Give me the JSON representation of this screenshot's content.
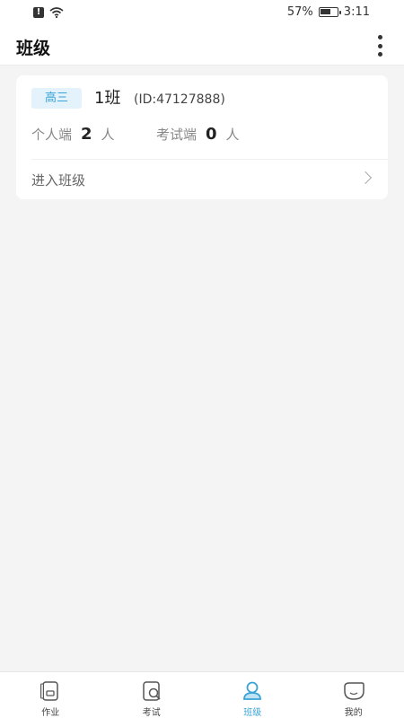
{
  "status_bar": {
    "battery_percent": "57%",
    "time": "3:11",
    "icons": [
      "alert-icon",
      "wifi-icon",
      "battery-icon"
    ]
  },
  "header": {
    "title": "班级",
    "menu_icon": "more-vertical-icon"
  },
  "class_card": {
    "grade": "高三",
    "name": "1班",
    "id_text": "(ID:47127888)",
    "personal": {
      "label": "个人端",
      "value": "2",
      "unit": "人"
    },
    "exam": {
      "label": "考试端",
      "value": "0",
      "unit": "人"
    },
    "enter_label": "进入班级"
  },
  "tabs": [
    {
      "label": "作业",
      "icon": "homework-icon",
      "active": false
    },
    {
      "label": "考试",
      "icon": "exam-icon",
      "active": false
    },
    {
      "label": "班级",
      "icon": "class-icon",
      "active": true
    },
    {
      "label": "我的",
      "icon": "profile-icon",
      "active": false
    }
  ],
  "colors": {
    "accent": "#3aa3d6",
    "badge_bg": "#e3f2fb",
    "background": "#f4f4f4"
  }
}
